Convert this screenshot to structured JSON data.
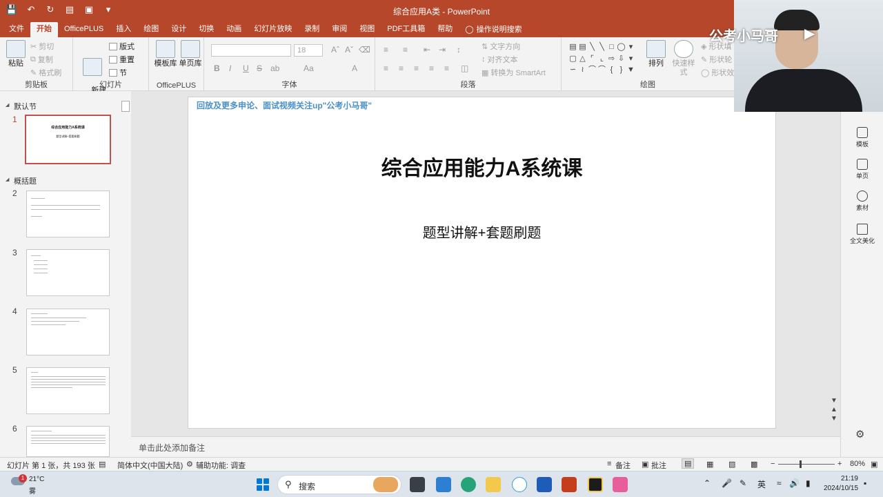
{
  "titlebar": {
    "title": "综合应用A类  -  PowerPoint",
    "qat_icons": [
      "save-icon",
      "undo-icon",
      "redo-icon",
      "present-icon",
      "touch-mode-icon",
      "customize-icon"
    ]
  },
  "tabs": [
    {
      "label": "文件"
    },
    {
      "label": "开始",
      "active": true
    },
    {
      "label": "OfficePLUS"
    },
    {
      "label": "插入"
    },
    {
      "label": "绘图"
    },
    {
      "label": "设计"
    },
    {
      "label": "切换"
    },
    {
      "label": "动画"
    },
    {
      "label": "幻灯片放映"
    },
    {
      "label": "录制"
    },
    {
      "label": "审阅"
    },
    {
      "label": "视图"
    },
    {
      "label": "PDF工具箱"
    },
    {
      "label": "帮助"
    },
    {
      "label": "操作说明搜索"
    }
  ],
  "ribbon": {
    "clipboard": {
      "label": "剪贴板",
      "paste": "粘贴",
      "cut": "剪切",
      "copy": "复制",
      "format_painter": "格式刷"
    },
    "slides": {
      "label": "幻灯片",
      "new_slide": "新建\n幻灯片",
      "layout": "版式",
      "reset": "重置",
      "section": "节"
    },
    "officeplus": {
      "label": "OfficePLUS",
      "template_lib": "模板库",
      "single_page_lib": "单页库"
    },
    "font": {
      "label": "字体",
      "font_name": "",
      "font_size": "18",
      "buttons": [
        "B",
        "I",
        "U",
        "S",
        "ab",
        "Aa",
        "A"
      ]
    },
    "paragraph": {
      "label": "段落",
      "text_direction": "文字方向",
      "align_text": "对齐文本",
      "convert_smartart": "转换为 SmartArt"
    },
    "drawing": {
      "label": "绘图",
      "arrange": "排列",
      "quick_styles": "快速样式",
      "shape_fill": "形状填",
      "shape_outline": "形状轮",
      "shape_effect": "形状效"
    }
  },
  "thumbnails": {
    "sections": [
      {
        "name": "默认节"
      },
      {
        "name": "概括题"
      }
    ],
    "slides": [
      {
        "num": "1",
        "title": "综合应用能力A系统课",
        "sub": "题型讲解+套题刷题",
        "selected": true
      },
      {
        "num": "2"
      },
      {
        "num": "3"
      },
      {
        "num": "4"
      },
      {
        "num": "5"
      },
      {
        "num": "6"
      }
    ]
  },
  "slide": {
    "banner": "回放及更多申论、面试视频关注up\"公考小马哥\"",
    "title": "综合应用能力A系统课",
    "subtitle": "题型讲解+套题刷题"
  },
  "sidepane": [
    {
      "label": "模板"
    },
    {
      "label": "单页"
    },
    {
      "label": "素材"
    },
    {
      "label": "全文美化"
    }
  ],
  "notes": {
    "placeholder": "单击此处添加备注"
  },
  "statusbar": {
    "slide_info": "幻灯片 第 1 张，共 193 张",
    "language": "简体中文(中国大陆)",
    "accessibility": "辅助功能: 调查",
    "notes_btn": "备注",
    "comments_btn": "批注",
    "zoom": "80%",
    "zoom_level": 0.38
  },
  "taskbar": {
    "weather_temp": "21°C",
    "weather_desc": "雾",
    "weather_badge": "1",
    "search_placeholder": "搜索",
    "ime": "英",
    "time": "21:19",
    "date": "2024/10/15"
  },
  "webcam": {
    "watermark": "公考小马哥"
  },
  "colors": {
    "accent": "#b7472a",
    "selection": "#c0504d",
    "banner": "#4a90c8"
  }
}
